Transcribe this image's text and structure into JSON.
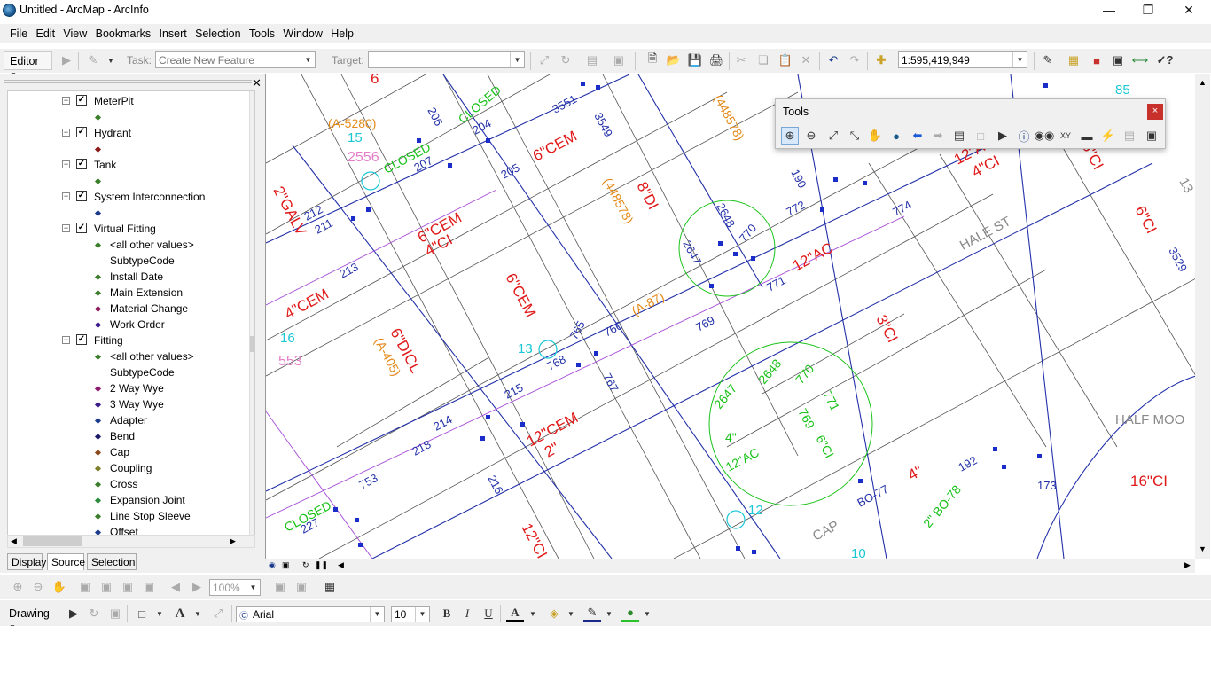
{
  "app": {
    "title": "Untitled - ArcMap - ArcInfo"
  },
  "menu": [
    "File",
    "Edit",
    "View",
    "Bookmarks",
    "Insert",
    "Selection",
    "Tools",
    "Window",
    "Help"
  ],
  "editor_toolbar": {
    "editor_label": "Editor",
    "task_label": "Task:",
    "task_value": "Create New Feature",
    "target_label": "Target:",
    "target_value": ""
  },
  "standard_toolbar": {
    "scale_value": "1:595,419,949"
  },
  "toc": {
    "layers": [
      {
        "name": "MeterPit",
        "type": "layer"
      },
      {
        "name": "",
        "type": "symbol",
        "color": "#3a7d2a"
      },
      {
        "name": "Hydrant",
        "type": "layer"
      },
      {
        "name": "",
        "type": "symbol",
        "color": "#8b1a1a"
      },
      {
        "name": "Tank",
        "type": "layer"
      },
      {
        "name": "",
        "type": "symbol",
        "color": "#3a7d2a"
      },
      {
        "name": "System Interconnection",
        "type": "layer"
      },
      {
        "name": "",
        "type": "symbol",
        "color": "#1a3a8b"
      },
      {
        "name": "Virtual Fitting",
        "type": "layer"
      },
      {
        "name": "<all other values>",
        "type": "symbol",
        "color": "#3a7d2a"
      },
      {
        "name": "SubtypeCode",
        "type": "heading"
      },
      {
        "name": "Install Date",
        "type": "symbol",
        "color": "#3a7d2a"
      },
      {
        "name": "Main Extension",
        "type": "symbol",
        "color": "#3a7d2a"
      },
      {
        "name": "Material Change",
        "type": "symbol",
        "color": "#8b1a5a"
      },
      {
        "name": "Work Order",
        "type": "symbol",
        "color": "#3a1a8b"
      },
      {
        "name": "Fitting",
        "type": "layer"
      },
      {
        "name": "<all other values>",
        "type": "symbol",
        "color": "#3a7d2a"
      },
      {
        "name": "SubtypeCode",
        "type": "heading"
      },
      {
        "name": "2 Way Wye",
        "type": "symbol",
        "color": "#8b1a6a"
      },
      {
        "name": "3 Way Wye",
        "type": "symbol",
        "color": "#3a1a8b"
      },
      {
        "name": "Adapter",
        "type": "symbol",
        "color": "#1a3a8b"
      },
      {
        "name": "Bend",
        "type": "symbol",
        "color": "#1a1a6b"
      },
      {
        "name": "Cap",
        "type": "symbol",
        "color": "#8b4a1a"
      },
      {
        "name": "Coupling",
        "type": "symbol",
        "color": "#7d7d2a"
      },
      {
        "name": "Cross",
        "type": "symbol",
        "color": "#3a7d2a"
      },
      {
        "name": "Expansion Joint",
        "type": "symbol",
        "color": "#2a8b3a"
      },
      {
        "name": "Line Stop Sleeve",
        "type": "symbol",
        "color": "#3a7d2a"
      },
      {
        "name": "Offset",
        "type": "symbol",
        "color": "#1a3a8b"
      }
    ],
    "tabs": [
      "Display",
      "Source",
      "Selection"
    ]
  },
  "tools_window": {
    "title": "Tools",
    "close": "×"
  },
  "layout_toolbar": {
    "zoom_value": "100%"
  },
  "drawing_toolbar": {
    "drawing_label": "Drawing",
    "font_value": "Arial",
    "size_value": "10",
    "bold": "B",
    "italic": "I",
    "underline": "U"
  },
  "map_labels": {
    "red": [
      "6",
      "2\"GALV",
      "6\"CEM",
      "8\"DI",
      "6\"CEM",
      "4\"CI",
      "12\"AC",
      "6\"CEM",
      "4\"CEM",
      "6\"DICL",
      "12\"CEM",
      "2\"",
      "3\"CI",
      "6\"CI",
      "12\"AC",
      "4\"CI",
      "6\"CI",
      "4\"",
      "16\"CI",
      "12\"CI"
    ],
    "orange": [
      "(A-5280)",
      "(448578)",
      "(448578)",
      "(A-87)",
      "(A-405)"
    ],
    "blue": [
      "206",
      "204",
      "3551",
      "3549",
      "207",
      "205",
      "212",
      "211",
      "213",
      "190",
      "772",
      "2648",
      "770",
      "2647",
      "771",
      "769",
      "765",
      "766",
      "768",
      "767",
      "215",
      "214",
      "218",
      "753",
      "216",
      "227",
      "774",
      "3529",
      "173",
      "192",
      "BO-77"
    ],
    "green": [
      "CLOSED",
      "CLOSED",
      "CLOSED",
      "2648",
      "2647",
      "770",
      "771",
      "769",
      "4\"",
      "12\"AC",
      "6\"CI",
      "2\" BO-78"
    ],
    "cyan": [
      "15",
      "85",
      "13",
      "16",
      "12",
      "10"
    ],
    "pink": [
      "2556",
      "553"
    ],
    "gray": [
      "HALE ST",
      "HALF MOO",
      "CAP",
      "13"
    ]
  }
}
